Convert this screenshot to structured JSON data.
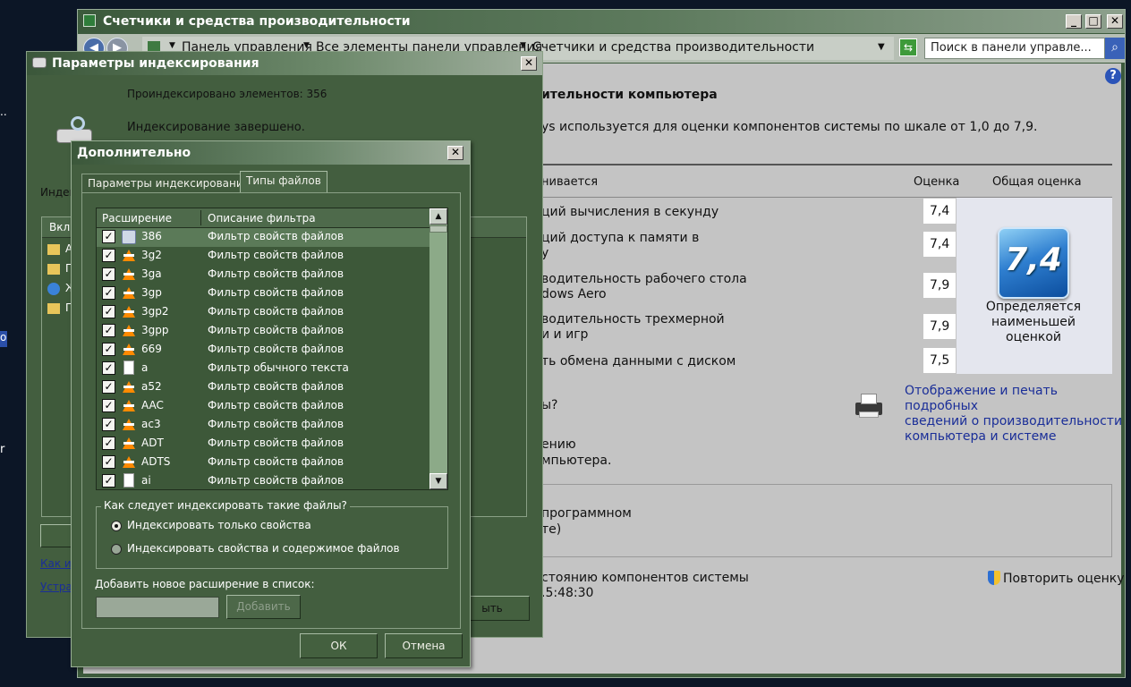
{
  "desktop": {
    "edge_fragments": [
      "..",
      "ol",
      "r"
    ]
  },
  "perf_window": {
    "title": "Счетчики и средства производительности",
    "breadcrumb": [
      "Панель управления",
      "Все элементы панели управления",
      "Счетчики и средства производительности"
    ],
    "search_placeholder": "Поиск в панели управле...",
    "heading": "ительности компьютера",
    "intro": "ys используется для оценки компонентов системы по шкале от 1,0 до 7,9.",
    "columns": {
      "component": "нивается",
      "score": "Оценка",
      "overall": "Общая оценка"
    },
    "rows": [
      {
        "line1": "ций вычисления в секунду",
        "line2": "",
        "score": "7,4"
      },
      {
        "line1": "ций доступа к памяти в",
        "line2": "у",
        "score": "7,4"
      },
      {
        "line1": "водительность рабочего стола",
        "line2": "dows Aero",
        "score": "7,9"
      },
      {
        "line1": "водительность трехмерной",
        "line2": "и и игр",
        "score": "7,9"
      },
      {
        "line1": "ть обмена данными с диском",
        "line2": "",
        "score": "7,5"
      }
    ],
    "overall_score": "7,4",
    "overall_caption": [
      "Определяется",
      "наименьшей",
      "оценкой"
    ],
    "link_question": "ы?",
    "link_print": [
      "Отображение и печать подробных",
      "сведений о производительности",
      "компьютера и системе"
    ],
    "link_more": [
      "ению",
      "мпьютера."
    ],
    "box_text": [
      "программном",
      "те)"
    ],
    "status_line1": "стоянию компонентов системы",
    "status_line2": ".5:48:30",
    "rerun_label": "Повторить оценку"
  },
  "index_window": {
    "title": "Параметры индексирования",
    "indexed_count": "Проиндексировано элементов: 356",
    "status": "Индексирование завершено.",
    "index_label": "Индек",
    "list_header": "Вклю",
    "list_items": [
      "А",
      "П",
      "Ж",
      "П"
    ],
    "link1": "Как и",
    "link2": "Устра",
    "close_button_label": "ыть"
  },
  "advanced_dialog": {
    "title": "Дополнительно",
    "tabs": [
      "Параметры индексирования",
      "Типы файлов"
    ],
    "table_headers": [
      "Расширение",
      "Описание фильтра"
    ],
    "file_types": [
      {
        "ext": "386",
        "desc": "Фильтр свойств файлов",
        "checked": true,
        "icon": "settings-file-icon"
      },
      {
        "ext": "3g2",
        "desc": "Фильтр свойств файлов",
        "checked": true,
        "icon": "vlc-cone-icon"
      },
      {
        "ext": "3ga",
        "desc": "Фильтр свойств файлов",
        "checked": true,
        "icon": "vlc-cone-icon"
      },
      {
        "ext": "3gp",
        "desc": "Фильтр свойств файлов",
        "checked": true,
        "icon": "vlc-cone-icon"
      },
      {
        "ext": "3gp2",
        "desc": "Фильтр свойств файлов",
        "checked": true,
        "icon": "vlc-cone-icon"
      },
      {
        "ext": "3gpp",
        "desc": "Фильтр свойств файлов",
        "checked": true,
        "icon": "vlc-cone-icon"
      },
      {
        "ext": "669",
        "desc": "Фильтр свойств файлов",
        "checked": true,
        "icon": "vlc-cone-icon"
      },
      {
        "ext": "a",
        "desc": "Фильтр обычного текста",
        "checked": true,
        "icon": "document-icon"
      },
      {
        "ext": "a52",
        "desc": "Фильтр свойств файлов",
        "checked": true,
        "icon": "vlc-cone-icon"
      },
      {
        "ext": "AAC",
        "desc": "Фильтр свойств файлов",
        "checked": true,
        "icon": "vlc-cone-icon"
      },
      {
        "ext": "ac3",
        "desc": "Фильтр свойств файлов",
        "checked": true,
        "icon": "vlc-cone-icon"
      },
      {
        "ext": "ADT",
        "desc": "Фильтр свойств файлов",
        "checked": true,
        "icon": "vlc-cone-icon"
      },
      {
        "ext": "ADTS",
        "desc": "Фильтр свойств файлов",
        "checked": true,
        "icon": "vlc-cone-icon"
      },
      {
        "ext": "ai",
        "desc": "Фильтр свойств файлов",
        "checked": true,
        "icon": "document-icon"
      }
    ],
    "group_label": "Как следует индексировать такие файлы?",
    "radio_options": [
      {
        "label": "Индексировать только свойства",
        "selected": true
      },
      {
        "label": "Индексировать свойства и содержимое файлов",
        "selected": false
      }
    ],
    "add_label": "Добавить новое расширение в список:",
    "add_input_value": "",
    "add_button": "Добавить",
    "ok_button": "ОК",
    "cancel_button": "Отмена"
  },
  "colors": {
    "dialog_bg": "#435e3f",
    "perf_content_bg": "#c4c4c4",
    "selection": "#5b7a58",
    "link": "#1a2e98"
  }
}
